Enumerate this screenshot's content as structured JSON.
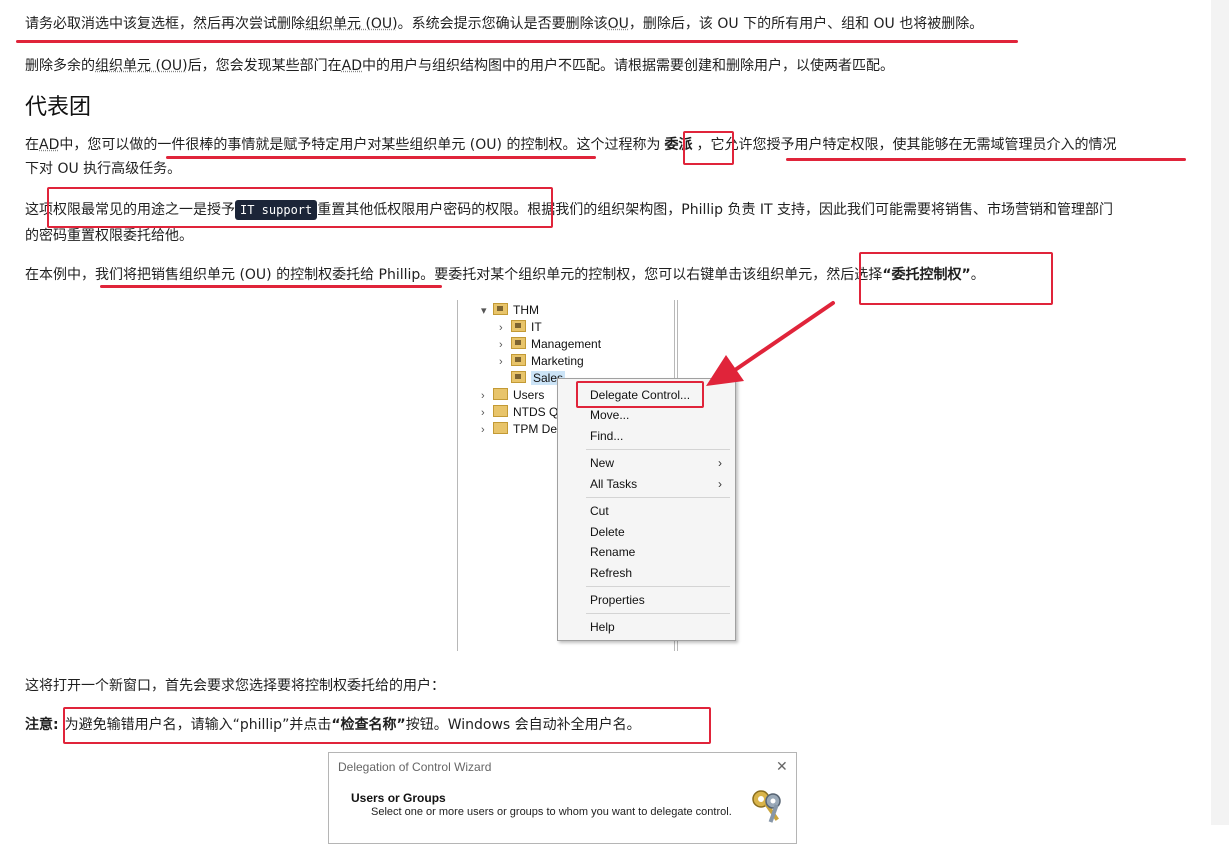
{
  "article": {
    "p1": {
      "a": "请务必取消选中该复选框，然后再次尝试删除",
      "b": "组织单元 (OU)",
      "c": "。系统会提示您确认是否要删除该",
      "d": "OU",
      "e": "，删除后，该 OU 下的所有用户、组和 OU 也将被删除。"
    },
    "p2": {
      "a": "删除多余的",
      "b": "组织单元 (OU)",
      "c": "后，您会发现某些部门在",
      "d": "AD",
      "e": "中的用户与组织结构图中的用户不匹配。请根据需要创建和删除用户，以使两者匹配。"
    },
    "heading": "代表团",
    "p3": {
      "a": "在",
      "b": "AD",
      "c": "中，您可以做的一件很棒的事情就是赋予特定用户对某些组织单元 (OU) 的控制权。这个过程称为",
      "d": "委派",
      "e": "，它允许您授予用户特定权限，使其能够在无需域管理员介入的情况",
      "f": "下对 OU 执行高级任务。"
    },
    "p4": {
      "a": "这项权限最常见的用途之一是授予",
      "code": "IT support",
      "b": "重置其他低权限用户密码的权限。根据我们的组织架构图，Phillip 负责 IT 支持，因此我们可能需要将销售、市场营销和管理部门",
      "c": "的密码重置权限委托给他。"
    },
    "p5": {
      "a": "在本例中，我们将把销售组织单元 (OU) 的控制权委托给 Phillip。要委托对某个组织单元的控制权，您可以右键单击该组织单元，然后选择",
      "b": "“委托控制权”",
      "c": "。"
    },
    "p6": "这将打开一个新窗口，首先会要求您选择要将控制权委托给的用户：",
    "p7": {
      "label": "注意:",
      "a": "为避免输错用户名，请输入“phillip”并点击",
      "b": "“检查名称”",
      "c": "按钮。Windows 会自动补全用户名。"
    }
  },
  "tree": {
    "nodes": [
      {
        "label": "THM",
        "chevron": "▾",
        "icon": "ou-folder-icon"
      },
      {
        "label": "IT",
        "chevron": "›",
        "icon": "ou-folder-icon"
      },
      {
        "label": "Management",
        "chevron": "›",
        "icon": "ou-folder-icon"
      },
      {
        "label": "Marketing",
        "chevron": "›",
        "icon": "ou-folder-icon"
      },
      {
        "label": "Sales",
        "chevron": "",
        "icon": "ou-folder-icon",
        "selected": true
      },
      {
        "label": "Users",
        "chevron": "›",
        "icon": "folder-icon"
      },
      {
        "label": "NTDS Qu",
        "chevron": "›",
        "icon": "folder-icon"
      },
      {
        "label": "TPM Dev",
        "chevron": "›",
        "icon": "folder-icon"
      }
    ]
  },
  "context_menu": {
    "items": [
      {
        "label": "Delegate Control..."
      },
      {
        "label": "Move..."
      },
      {
        "label": "Find..."
      },
      {
        "label": "New",
        "submenu": true
      },
      {
        "label": "All Tasks",
        "submenu": true
      },
      {
        "label": "Cut"
      },
      {
        "label": "Delete"
      },
      {
        "label": "Rename"
      },
      {
        "label": "Refresh"
      },
      {
        "label": "Properties"
      },
      {
        "label": "Help"
      }
    ],
    "submenu_glyph": "›"
  },
  "wizard": {
    "title": "Delegation of Control Wizard",
    "close_glyph": "✕",
    "heading": "Users or Groups",
    "subtitle": "Select one or more users or groups to whom you want to delegate control.",
    "icon": "keys-icon"
  },
  "colors": {
    "annotation_red": "#e0243a",
    "code_bg": "#1c2538",
    "selection_blue": "#cce4f7"
  }
}
